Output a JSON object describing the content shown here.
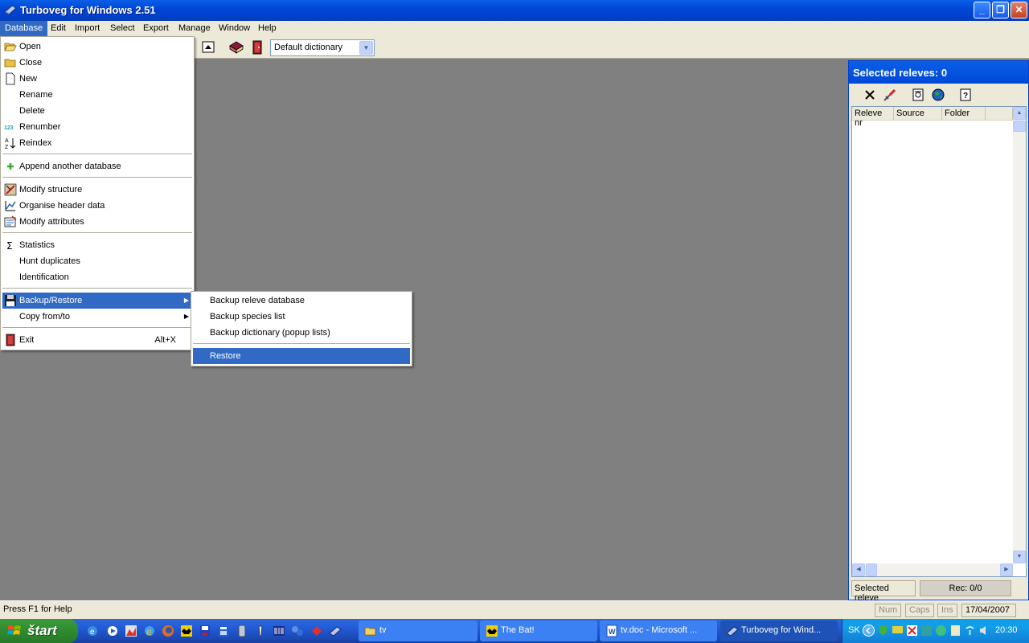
{
  "window": {
    "title": "Turboveg for Windows 2.51"
  },
  "menubar": {
    "items": [
      "Database",
      "Edit",
      "Import",
      "Select",
      "Export",
      "Manage",
      "Window",
      "Help"
    ]
  },
  "toolbar": {
    "dictionary_select": "Default dictionary"
  },
  "database_menu": {
    "items": [
      {
        "label": "Open",
        "icon": "open-folder-icon"
      },
      {
        "label": "Close",
        "icon": "folder-icon"
      },
      {
        "label": "New",
        "icon": "new-document-icon"
      },
      {
        "label": "Rename"
      },
      {
        "label": "Delete"
      },
      {
        "label": "Renumber",
        "icon": "renumber-icon"
      },
      {
        "label": "Reindex",
        "icon": "sort-icon"
      },
      {
        "label": "Append another database",
        "icon": "plus-icon"
      },
      {
        "label": "Modify structure",
        "icon": "modify-structure-icon"
      },
      {
        "label": "Organise header data",
        "icon": "organise-header-icon"
      },
      {
        "label": "Modify attributes",
        "icon": "modify-attributes-icon"
      },
      {
        "label": "Statistics",
        "icon": "sigma-icon"
      },
      {
        "label": "Hunt duplicates"
      },
      {
        "label": "Identification"
      },
      {
        "label": "Backup/Restore",
        "icon": "floppy-icon"
      },
      {
        "label": "Copy from/to"
      },
      {
        "label": "Exit",
        "icon": "exit-door-icon",
        "accel": "Alt+X"
      }
    ]
  },
  "backup_submenu": {
    "items": [
      "Backup releve database",
      "Backup species list",
      "Backup dictionary (popup lists)",
      "Restore"
    ]
  },
  "selected_panel": {
    "title": "Selected releves: 0",
    "columns": [
      "Releve nr",
      "Source",
      "Folder"
    ],
    "status_left": "Selected releve",
    "status_right": "Rec: 0/0"
  },
  "statusbar": {
    "help": "Press F1 for Help",
    "num": "Num",
    "caps": "Caps",
    "ins": "Ins",
    "date": "17/04/2007"
  },
  "taskbar": {
    "start": "štart",
    "tasks": [
      "tv",
      "The Bat!",
      "tv.doc - Microsoft ...",
      "Turboveg for Wind..."
    ],
    "lang": "SK",
    "clock": "20:30"
  }
}
